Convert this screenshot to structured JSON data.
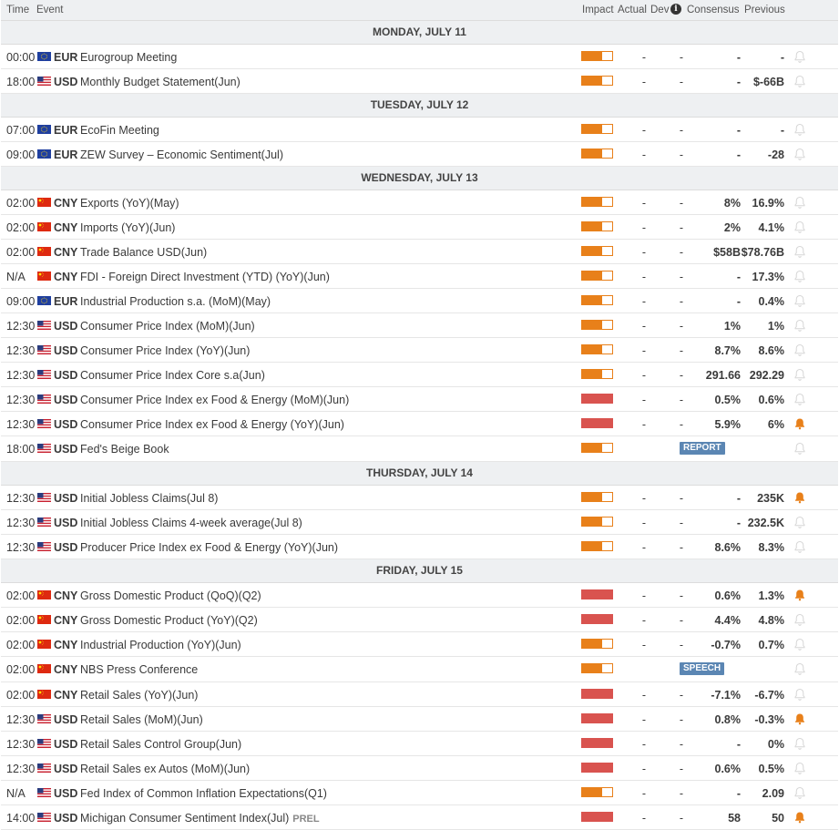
{
  "header": {
    "time": "Time",
    "event": "Event",
    "impact": "Impact",
    "actual": "Actual",
    "dev": "Dev",
    "info_icon": "i",
    "consensus": "Consensus",
    "previous": "Previous"
  },
  "colors": {
    "medium": "#e8801a",
    "high": "#d9534f",
    "bell_active": "#e8801a",
    "bell_inactive": "#d6d6d6"
  },
  "days": [
    {
      "label": "MONDAY, JULY 11",
      "events": [
        {
          "time": "00:00",
          "flag": "eu",
          "cur": "EUR",
          "name": "Eurogroup Meeting",
          "impact": "medium",
          "actual": "-",
          "dev": "-",
          "cons": "-",
          "prev": "-",
          "alert": false
        },
        {
          "time": "18:00",
          "flag": "us",
          "cur": "USD",
          "name": "Monthly Budget Statement(Jun)",
          "impact": "medium",
          "actual": "-",
          "dev": "-",
          "cons": "-",
          "prev": "$-66B",
          "alert": false
        }
      ]
    },
    {
      "label": "TUESDAY, JULY 12",
      "events": [
        {
          "time": "07:00",
          "flag": "eu",
          "cur": "EUR",
          "name": "EcoFin Meeting",
          "impact": "medium",
          "actual": "-",
          "dev": "-",
          "cons": "-",
          "prev": "-",
          "alert": false
        },
        {
          "time": "09:00",
          "flag": "eu",
          "cur": "EUR",
          "name": "ZEW Survey – Economic Sentiment(Jul)",
          "impact": "medium",
          "actual": "-",
          "dev": "-",
          "cons": "-",
          "prev": "-28",
          "alert": false
        }
      ]
    },
    {
      "label": "WEDNESDAY, JULY 13",
      "events": [
        {
          "time": "02:00",
          "flag": "cn",
          "cur": "CNY",
          "name": "Exports (YoY)(May)",
          "impact": "medium",
          "actual": "-",
          "dev": "-",
          "cons": "8%",
          "prev": "16.9%",
          "alert": false
        },
        {
          "time": "02:00",
          "flag": "cn",
          "cur": "CNY",
          "name": "Imports (YoY)(Jun)",
          "impact": "medium",
          "actual": "-",
          "dev": "-",
          "cons": "2%",
          "prev": "4.1%",
          "alert": false
        },
        {
          "time": "02:00",
          "flag": "cn",
          "cur": "CNY",
          "name": "Trade Balance USD(Jun)",
          "impact": "medium",
          "actual": "-",
          "dev": "-",
          "cons": "$58B",
          "prev": "$78.76B",
          "alert": false
        },
        {
          "time": "N/A",
          "flag": "cn",
          "cur": "CNY",
          "name": "FDI - Foreign Direct Investment (YTD) (YoY)(Jun)",
          "impact": "medium",
          "actual": "-",
          "dev": "-",
          "cons": "-",
          "prev": "17.3%",
          "alert": false
        },
        {
          "time": "09:00",
          "flag": "eu",
          "cur": "EUR",
          "name": "Industrial Production s.a. (MoM)(May)",
          "impact": "medium",
          "actual": "-",
          "dev": "-",
          "cons": "-",
          "prev": "0.4%",
          "alert": false
        },
        {
          "time": "12:30",
          "flag": "us",
          "cur": "USD",
          "name": "Consumer Price Index (MoM)(Jun)",
          "impact": "medium",
          "actual": "-",
          "dev": "-",
          "cons": "1%",
          "prev": "1%",
          "alert": false
        },
        {
          "time": "12:30",
          "flag": "us",
          "cur": "USD",
          "name": "Consumer Price Index (YoY)(Jun)",
          "impact": "medium",
          "actual": "-",
          "dev": "-",
          "cons": "8.7%",
          "prev": "8.6%",
          "alert": false
        },
        {
          "time": "12:30",
          "flag": "us",
          "cur": "USD",
          "name": "Consumer Price Index Core s.a(Jun)",
          "impact": "medium",
          "actual": "-",
          "dev": "-",
          "cons": "291.66",
          "prev": "292.29",
          "alert": false
        },
        {
          "time": "12:30",
          "flag": "us",
          "cur": "USD",
          "name": "Consumer Price Index ex Food & Energy (MoM)(Jun)",
          "impact": "high",
          "actual": "-",
          "dev": "-",
          "cons": "0.5%",
          "prev": "0.6%",
          "alert": false
        },
        {
          "time": "12:30",
          "flag": "us",
          "cur": "USD",
          "name": "Consumer Price Index ex Food & Energy (YoY)(Jun)",
          "impact": "high",
          "actual": "-",
          "dev": "-",
          "cons": "5.9%",
          "prev": "6%",
          "alert": true
        },
        {
          "time": "18:00",
          "flag": "us",
          "cur": "USD",
          "name": "Fed's Beige Book",
          "impact": "medium",
          "badge": "REPORT",
          "alert": false
        }
      ]
    },
    {
      "label": "THURSDAY, JULY 14",
      "events": [
        {
          "time": "12:30",
          "flag": "us",
          "cur": "USD",
          "name": "Initial Jobless Claims(Jul 8)",
          "impact": "medium",
          "actual": "-",
          "dev": "-",
          "cons": "-",
          "prev": "235K",
          "alert": true
        },
        {
          "time": "12:30",
          "flag": "us",
          "cur": "USD",
          "name": "Initial Jobless Claims 4-week average(Jul 8)",
          "impact": "medium",
          "actual": "-",
          "dev": "-",
          "cons": "-",
          "prev": "232.5K",
          "alert": false
        },
        {
          "time": "12:30",
          "flag": "us",
          "cur": "USD",
          "name": "Producer Price Index ex Food & Energy (YoY)(Jun)",
          "impact": "medium",
          "actual": "-",
          "dev": "-",
          "cons": "8.6%",
          "prev": "8.3%",
          "alert": false
        }
      ]
    },
    {
      "label": "FRIDAY, JULY 15",
      "events": [
        {
          "time": "02:00",
          "flag": "cn",
          "cur": "CNY",
          "name": "Gross Domestic Product (QoQ)(Q2)",
          "impact": "high",
          "actual": "-",
          "dev": "-",
          "cons": "0.6%",
          "prev": "1.3%",
          "alert": true
        },
        {
          "time": "02:00",
          "flag": "cn",
          "cur": "CNY",
          "name": "Gross Domestic Product (YoY)(Q2)",
          "impact": "high",
          "actual": "-",
          "dev": "-",
          "cons": "4.4%",
          "prev": "4.8%",
          "alert": false
        },
        {
          "time": "02:00",
          "flag": "cn",
          "cur": "CNY",
          "name": "Industrial Production (YoY)(Jun)",
          "impact": "medium",
          "actual": "-",
          "dev": "-",
          "cons": "-0.7%",
          "prev": "0.7%",
          "alert": false
        },
        {
          "time": "02:00",
          "flag": "cn",
          "cur": "CNY",
          "name": "NBS Press Conference",
          "impact": "medium",
          "badge": "SPEECH",
          "alert": false
        },
        {
          "time": "02:00",
          "flag": "cn",
          "cur": "CNY",
          "name": "Retail Sales (YoY)(Jun)",
          "impact": "high",
          "actual": "-",
          "dev": "-",
          "cons": "-7.1%",
          "prev": "-6.7%",
          "alert": false
        },
        {
          "time": "12:30",
          "flag": "us",
          "cur": "USD",
          "name": "Retail Sales (MoM)(Jun)",
          "impact": "high",
          "actual": "-",
          "dev": "-",
          "cons": "0.8%",
          "prev": "-0.3%",
          "alert": true
        },
        {
          "time": "12:30",
          "flag": "us",
          "cur": "USD",
          "name": "Retail Sales Control Group(Jun)",
          "impact": "high",
          "actual": "-",
          "dev": "-",
          "cons": "-",
          "prev": "0%",
          "alert": false
        },
        {
          "time": "12:30",
          "flag": "us",
          "cur": "USD",
          "name": "Retail Sales ex Autos (MoM)(Jun)",
          "impact": "high",
          "actual": "-",
          "dev": "-",
          "cons": "0.6%",
          "prev": "0.5%",
          "alert": false
        },
        {
          "time": "N/A",
          "flag": "us",
          "cur": "USD",
          "name": "Fed Index of Common Inflation Expectations(Q1)",
          "impact": "medium",
          "actual": "-",
          "dev": "-",
          "cons": "-",
          "prev": "2.09",
          "alert": false
        },
        {
          "time": "14:00",
          "flag": "us",
          "cur": "USD",
          "name": "Michigan Consumer Sentiment Index(Jul)",
          "tag": "PREL",
          "impact": "high",
          "actual": "-",
          "dev": "-",
          "cons": "58",
          "prev": "50",
          "alert": true
        }
      ]
    }
  ]
}
